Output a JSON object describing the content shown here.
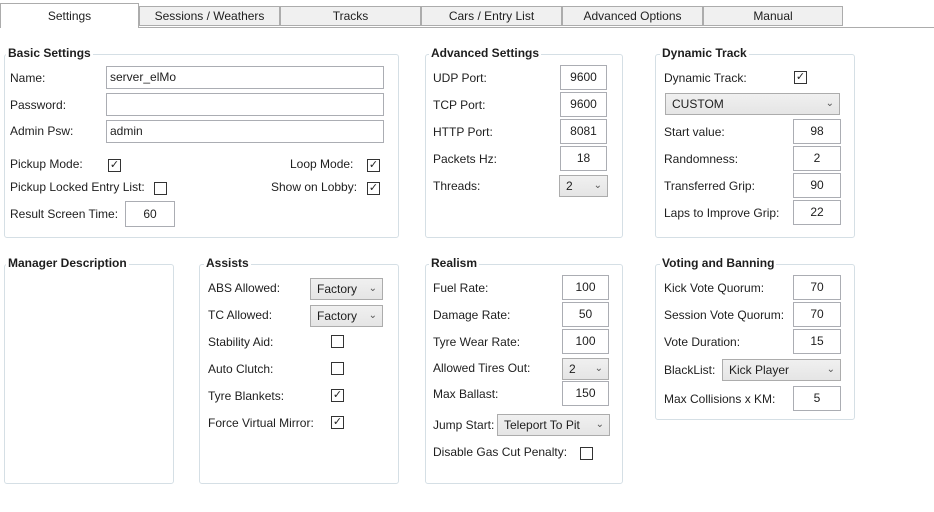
{
  "tabs": [
    "Settings",
    "Sessions / Weathers",
    "Tracks",
    "Cars / Entry List",
    "Advanced Options",
    "Manual"
  ],
  "basic": {
    "title": "Basic Settings",
    "name_label": "Name:",
    "name_value": "server_elMo",
    "password_label": "Password:",
    "password_value": "",
    "admin_label": "Admin Psw:",
    "admin_value": "admin",
    "pickup_label": "Pickup Mode:",
    "pickup_checked": "✓",
    "loop_label": "Loop Mode:",
    "loop_checked": "✓",
    "pickup_locked_label": "Pickup Locked Entry List:",
    "pickup_locked_checked": "",
    "show_lobby_label": "Show on Lobby:",
    "show_lobby_checked": "✓",
    "result_time_label": "Result Screen Time:",
    "result_time_value": "60"
  },
  "advanced": {
    "title": "Advanced Settings",
    "udp_label": "UDP Port:",
    "udp_value": "9600",
    "tcp_label": "TCP Port:",
    "tcp_value": "9600",
    "http_label": "HTTP Port:",
    "http_value": "8081",
    "packets_label": "Packets Hz:",
    "packets_value": "18",
    "threads_label": "Threads:",
    "threads_value": "2"
  },
  "dynamic": {
    "title": "Dynamic Track",
    "enabled_label": "Dynamic Track:",
    "enabled_checked": "✓",
    "preset_value": "CUSTOM",
    "start_label": "Start value:",
    "start_value": "98",
    "random_label": "Randomness:",
    "random_value": "2",
    "grip_label": "Transferred Grip:",
    "grip_value": "90",
    "laps_label": "Laps to Improve Grip:",
    "laps_value": "22"
  },
  "manager": {
    "title": "Manager Description"
  },
  "assists": {
    "title": "Assists",
    "abs_label": "ABS Allowed:",
    "abs_value": "Factory",
    "tc_label": "TC Allowed:",
    "tc_value": "Factory",
    "stability_label": "Stability Aid:",
    "stability_checked": "",
    "clutch_label": "Auto Clutch:",
    "clutch_checked": "",
    "blankets_label": "Tyre Blankets:",
    "blankets_checked": "✓",
    "mirror_label": "Force Virtual Mirror:",
    "mirror_checked": "✓"
  },
  "realism": {
    "title": "Realism",
    "fuel_label": "Fuel Rate:",
    "fuel_value": "100",
    "damage_label": "Damage Rate:",
    "damage_value": "50",
    "tyre_label": "Tyre Wear Rate:",
    "tyre_value": "100",
    "tires_out_label": "Allowed Tires Out:",
    "tires_out_value": "2",
    "ballast_label": "Max Ballast:",
    "ballast_value": "150",
    "jump_label": "Jump Start:",
    "jump_value": "Teleport To Pit",
    "gascut_label": "Disable Gas Cut Penalty:",
    "gascut_checked": ""
  },
  "voting": {
    "title": "Voting and Banning",
    "kick_label": "Kick Vote Quorum:",
    "kick_value": "70",
    "session_label": "Session Vote Quorum:",
    "session_value": "70",
    "duration_label": "Vote Duration:",
    "duration_value": "15",
    "blacklist_label": "BlackList:",
    "blacklist_value": "Kick Player",
    "collisions_label": "Max Collisions x KM:",
    "collisions_value": "5"
  }
}
